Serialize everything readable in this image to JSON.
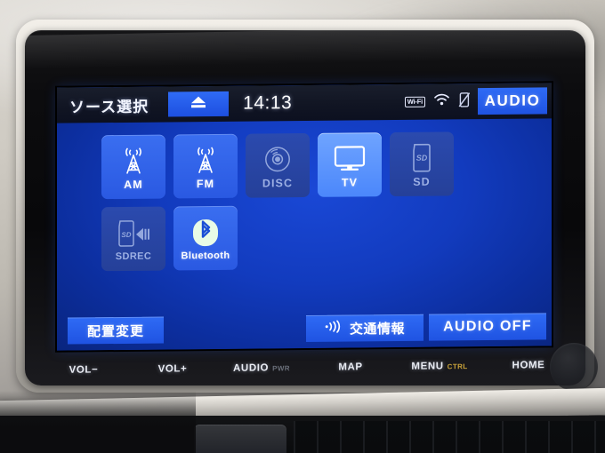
{
  "device": {
    "type": "car-audio-head-unit",
    "screen_title": "ソース選択"
  },
  "titlebar": {
    "title": "ソース選択",
    "eject_icon": "eject-icon",
    "clock": "14:13",
    "status": {
      "wifi_badge_text": "Wi-Fi",
      "wifi_signal_icon": "wifi-signal-icon",
      "phone_off_icon": "phone-disconnected-icon"
    },
    "audio_button": "AUDIO"
  },
  "sources": {
    "rows": [
      [
        {
          "label": "AM",
          "icon": "radio-tower-icon",
          "state": "active"
        },
        {
          "label": "FM",
          "icon": "radio-tower-icon",
          "state": "active"
        },
        {
          "label": "DISC",
          "icon": "disc-icon",
          "state": "disabled"
        },
        {
          "label": "TV",
          "icon": "television-icon",
          "state": "selected"
        },
        {
          "label": "SD",
          "icon": "sd-card-icon",
          "state": "disabled"
        }
      ],
      [
        {
          "label": "SDREC",
          "icon": "sd-record-icon",
          "state": "disabled"
        },
        {
          "label": "Bluetooth",
          "icon": "bluetooth-icon",
          "state": "active"
        }
      ]
    ]
  },
  "actions": {
    "layout_change": "配置変更",
    "traffic_info": "交通情報",
    "traffic_icon": "broadcast-icon",
    "audio_off": "AUDIO OFF"
  },
  "hardware_buttons": [
    {
      "label": "VOL−",
      "sub": ""
    },
    {
      "label": "VOL+",
      "sub": ""
    },
    {
      "label": "AUDIO",
      "sub": "PWR"
    },
    {
      "label": "MAP",
      "sub": ""
    },
    {
      "label": "MENU",
      "sub": "CTRL"
    },
    {
      "label": "HOME",
      "sub": ""
    }
  ],
  "colors": {
    "screen_blue": "#123bbe",
    "button_blue": "#2f6bf5",
    "selected_blue": "#6fa4ff",
    "disabled_blue": "#2b4aae",
    "titlebar_dark": "#111523",
    "text_white": "#ffffff",
    "ctrl_amber": "#c9a33a"
  }
}
